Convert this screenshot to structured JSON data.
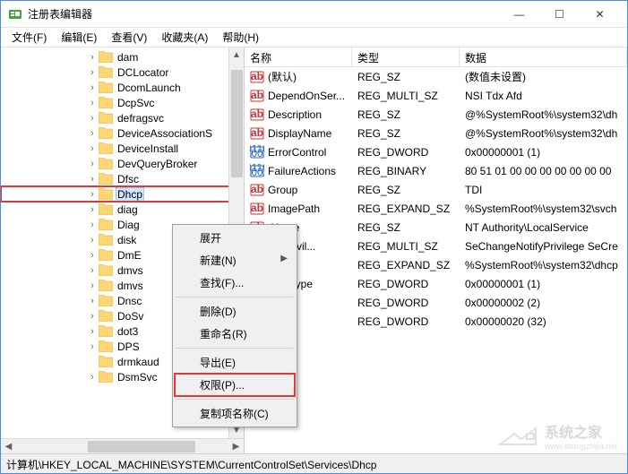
{
  "window": {
    "title": "注册表编辑器",
    "controls": {
      "min": "—",
      "max": "☐",
      "close": "✕"
    }
  },
  "menubar": [
    "文件(F)",
    "编辑(E)",
    "查看(V)",
    "收藏夹(A)",
    "帮助(H)"
  ],
  "tree": {
    "indent_base": 96,
    "items": [
      {
        "label": "dam",
        "expander": ">"
      },
      {
        "label": "DCLocator",
        "expander": ">"
      },
      {
        "label": "DcomLaunch",
        "expander": ">"
      },
      {
        "label": "DcpSvc",
        "expander": ">"
      },
      {
        "label": "defragsvc",
        "expander": ">"
      },
      {
        "label": "DeviceAssociationS",
        "expander": ">"
      },
      {
        "label": "DeviceInstall",
        "expander": ">"
      },
      {
        "label": "DevQueryBroker",
        "expander": ">"
      },
      {
        "label": "Dfsc",
        "expander": ">"
      },
      {
        "label": "Dhcp",
        "expander": ">",
        "selected": true,
        "highlight": true
      },
      {
        "label": "diag",
        "expander": ">"
      },
      {
        "label": "Diag",
        "expander": ">"
      },
      {
        "label": "disk",
        "expander": ">"
      },
      {
        "label": "DmE",
        "expander": ">"
      },
      {
        "label": "dmvs",
        "expander": ">"
      },
      {
        "label": "dmvs",
        "expander": ">"
      },
      {
        "label": "Dnsc",
        "expander": ">"
      },
      {
        "label": "DoSv",
        "expander": ">"
      },
      {
        "label": "dot3",
        "expander": ">"
      },
      {
        "label": "DPS",
        "expander": ">"
      },
      {
        "label": "drmkaud",
        "expander": " "
      },
      {
        "label": "DsmSvc",
        "expander": ">"
      }
    ]
  },
  "list": {
    "columns": {
      "name": "名称",
      "type": "类型",
      "data": "数据"
    },
    "rows": [
      {
        "icon": "str",
        "name": "(默认)",
        "type": "REG_SZ",
        "data": "(数值未设置)"
      },
      {
        "icon": "str",
        "name": "DependOnSer...",
        "type": "REG_MULTI_SZ",
        "data": "NSI Tdx Afd"
      },
      {
        "icon": "str",
        "name": "Description",
        "type": "REG_SZ",
        "data": "@%SystemRoot%\\system32\\dh"
      },
      {
        "icon": "str",
        "name": "DisplayName",
        "type": "REG_SZ",
        "data": "@%SystemRoot%\\system32\\dh"
      },
      {
        "icon": "bin",
        "name": "ErrorControl",
        "type": "REG_DWORD",
        "data": "0x00000001 (1)"
      },
      {
        "icon": "bin",
        "name": "FailureActions",
        "type": "REG_BINARY",
        "data": "80 51 01 00 00 00 00 00 00 00"
      },
      {
        "icon": "str",
        "name": "Group",
        "type": "REG_SZ",
        "data": "TDI"
      },
      {
        "icon": "str",
        "name": "ImagePath",
        "type": "REG_EXPAND_SZ",
        "data": "%SystemRoot%\\system32\\svch"
      },
      {
        "icon": "str",
        "name": "tName",
        "type": "REG_SZ",
        "data": "NT Authority\\LocalService"
      },
      {
        "icon": "str",
        "name": "redPrivil...",
        "type": "REG_MULTI_SZ",
        "data": "SeChangeNotifyPrivilege SeCre"
      },
      {
        "icon": "str",
        "name": "eDll",
        "type": "REG_EXPAND_SZ",
        "data": "%SystemRoot%\\system32\\dhcp"
      },
      {
        "icon": "bin",
        "name": "eSidType",
        "type": "REG_DWORD",
        "data": "0x00000001 (1)"
      },
      {
        "icon": "bin",
        "name": "",
        "type": "REG_DWORD",
        "data": "0x00000002 (2)"
      },
      {
        "icon": "bin",
        "name": "",
        "type": "REG_DWORD",
        "data": "0x00000020 (32)"
      }
    ]
  },
  "context_menu": [
    {
      "label": "展开",
      "type": "item"
    },
    {
      "label": "新建(N)",
      "type": "submenu"
    },
    {
      "label": "查找(F)...",
      "type": "item"
    },
    {
      "type": "sep"
    },
    {
      "label": "删除(D)",
      "type": "item"
    },
    {
      "label": "重命名(R)",
      "type": "item"
    },
    {
      "type": "sep"
    },
    {
      "label": "导出(E)",
      "type": "item"
    },
    {
      "label": "权限(P)...",
      "type": "item",
      "highlight": true
    },
    {
      "type": "sep"
    },
    {
      "label": "复制项名称(C)",
      "type": "item"
    }
  ],
  "statusbar": "计算机\\HKEY_LOCAL_MACHINE\\SYSTEM\\CurrentControlSet\\Services\\Dhcp",
  "watermark": {
    "brand": "系统之家",
    "sub": "www.xitongzhijia.net"
  }
}
